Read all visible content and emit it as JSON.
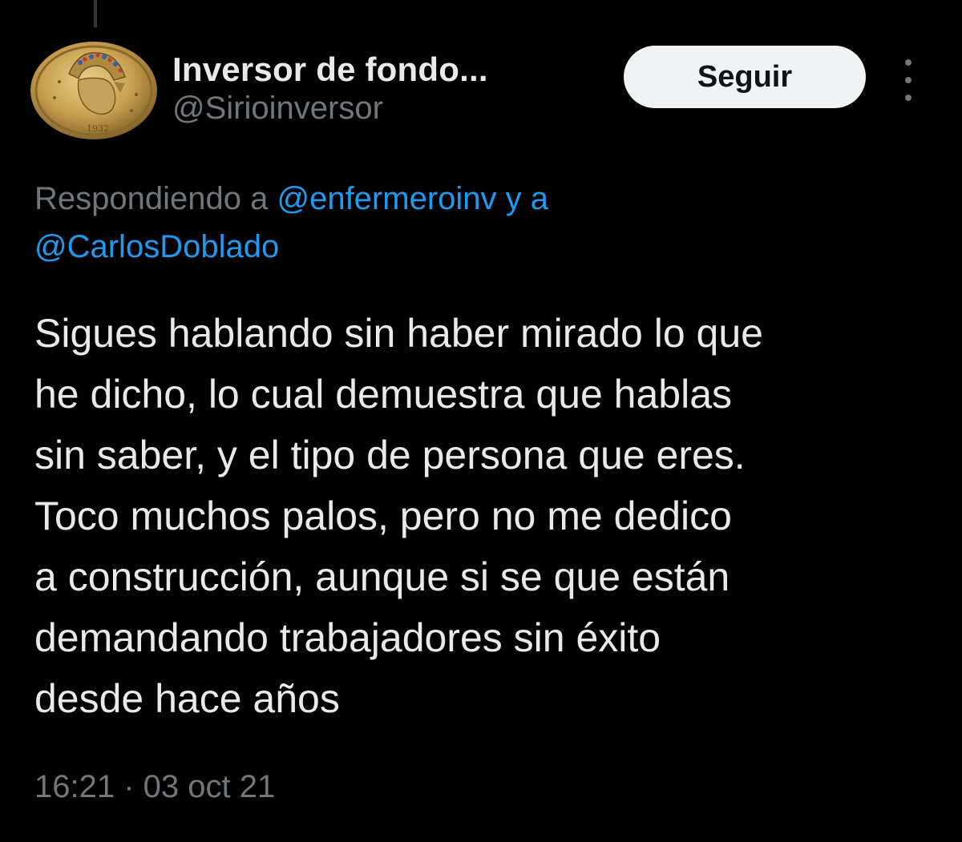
{
  "author": {
    "display_name": "Inversor de fondo...",
    "handle": "@Sirioinversor",
    "avatar_icon": "gold-coin-avatar-icon"
  },
  "actions": {
    "follow_label": "Seguir",
    "more_icon": "more-options-icon"
  },
  "reply_context": {
    "prefix": "Respondiendo a ",
    "mention_1": "@enfermeroinv",
    "connector": " y a",
    "mention_2": "@CarlosDoblado"
  },
  "tweet": {
    "lines": [
      "Sigues hablando sin haber mirado lo que",
      "he dicho, lo cual demuestra que hablas",
      "sin saber, y el tipo de persona que eres.",
      "Toco muchos palos, pero no me dedico",
      "a construcción, aunque si se que están",
      "demandando trabajadores sin éxito",
      "desde hace años"
    ]
  },
  "meta": {
    "timestamp": "16:21 · 03 oct 21"
  },
  "colors": {
    "background": "#000000",
    "text_primary": "#e7e9ea",
    "text_secondary": "#71767b",
    "accent_link": "#1d9bf0",
    "button_bg": "#eff3f4",
    "button_text": "#0f1419"
  }
}
